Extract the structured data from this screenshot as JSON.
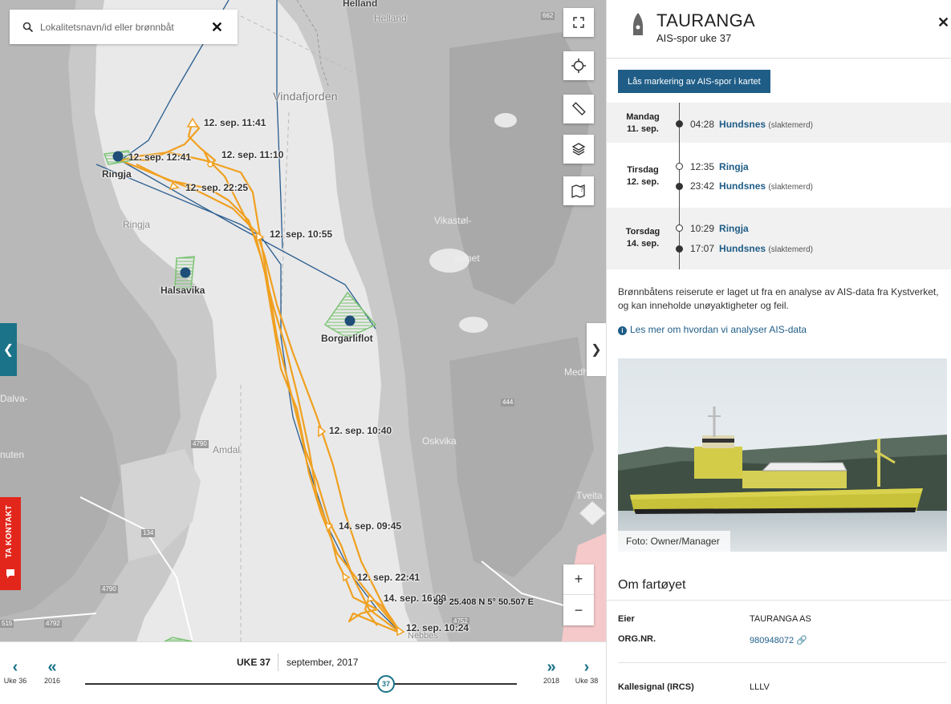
{
  "search": {
    "placeholder": "Lokalitetsnavn/id eller brønnbåt"
  },
  "map": {
    "place_names": {
      "helland_top": "Helland",
      "helland": "Helland",
      "vindafjorden": "Vindafjorden",
      "ringja": "Ringja",
      "vikastol": "Vikastøl-",
      "vatnet": "vatnet",
      "medh": "Medh",
      "dalva": "Dalva-",
      "nuten": "nuten",
      "amdal": "Amdal",
      "oskvika": "Oskvika",
      "tveita": "Tveita",
      "neboes": "Nebbes"
    },
    "road_numbers": {
      "r4790a": "4790",
      "r4790b": "4790",
      "r134": "134",
      "r4792": "4792",
      "r515": "515",
      "r444": "444",
      "r662": "662",
      "r4752": "4752"
    },
    "sites": {
      "ringja": "Ringja",
      "halsavika": "Halsavika",
      "borgarliflot": "Borgarliflot"
    },
    "track_labels": {
      "l1141": "12. sep. 11:41",
      "l1241": "12. sep. 12:41",
      "l1110": "12. sep. 11:10",
      "l2225": "12. sep. 22:25",
      "l1055": "12. sep. 10:55",
      "l1040": "12. sep. 10:40",
      "l0945": "14. sep. 09:45",
      "l2241": "12. sep. 22:41",
      "l1609": "14. sep. 16:09",
      "l1024": "12. sep. 10:24"
    },
    "coordinates": "59° 25.408 N 5° 50.507 E",
    "colors": {
      "track": "#f0a020",
      "ais_line": "#2a5d8f",
      "site": "#1f4e79",
      "farm": "#7cc474"
    },
    "icons": [
      "fullscreen-icon",
      "locate-icon",
      "ruler-icon",
      "layers-icon",
      "map-help-icon"
    ],
    "zoom_in": "+",
    "zoom_out": "−"
  },
  "contact_tab": "TA KONTAKT",
  "timeline": {
    "prev_week": "Uke 36",
    "prev_year": "2016",
    "next_year": "2018",
    "next_week": "Uke 38",
    "week": "UKE 37",
    "month": "september, 2017",
    "knob": "37"
  },
  "panel": {
    "vessel_name": "TAURANGA",
    "subtitle": "AIS-spor uke 37",
    "lock_button": "Lås markering av AIS-spor i kartet",
    "days": [
      {
        "day": "Mandag",
        "date": "11. sep.",
        "stops": [
          {
            "time": "04:28",
            "place": "Hundsnes",
            "note": "(slaktemerd)"
          }
        ]
      },
      {
        "day": "Tirsdag",
        "date": "12. sep.",
        "stops": [
          {
            "time": "12:35",
            "place": "Ringja",
            "note": ""
          },
          {
            "time": "23:42",
            "place": "Hundsnes",
            "note": "(slaktemerd)"
          }
        ]
      },
      {
        "day": "Torsdag",
        "date": "14. sep.",
        "stops": [
          {
            "time": "10:29",
            "place": "Ringja",
            "note": ""
          },
          {
            "time": "17:07",
            "place": "Hundsnes",
            "note": "(slaktemerd)"
          }
        ]
      }
    ],
    "disclaimer": "Brønnbåtens reiserute er laget ut fra en analyse av AIS-data fra Kystverket, og kan inneholde unøyaktigheter og feil.",
    "learn_more": "Les mer om hvordan vi analyser AIS-data",
    "photo_caption": "Foto: Owner/Manager",
    "about_title": "Om fartøyet",
    "owner_label": "Eier",
    "owner_value": "TAURANGA AS",
    "org_label": "ORG.NR.",
    "org_value": "980948072",
    "callsign_label": "Kallesignal (IRCS)",
    "callsign_value": "LLLV"
  }
}
